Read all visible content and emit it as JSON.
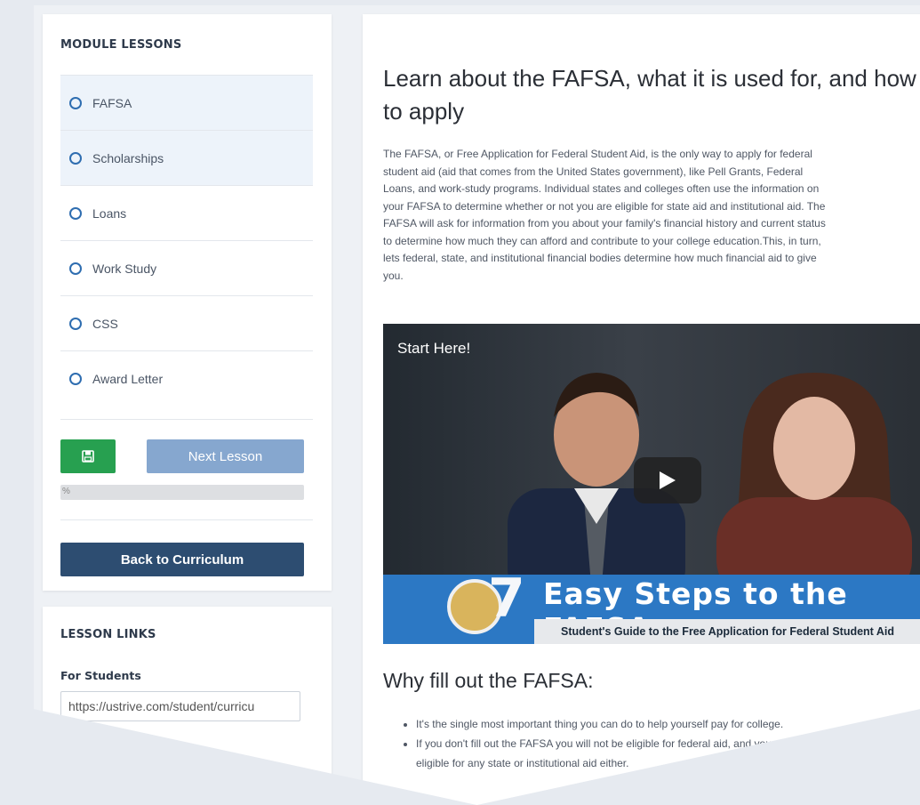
{
  "sidebar": {
    "module_title": "MODULE LESSONS",
    "lessons": [
      {
        "label": "FAFSA"
      },
      {
        "label": "Scholarships"
      },
      {
        "label": "Loans"
      },
      {
        "label": "Work Study"
      },
      {
        "label": "CSS"
      },
      {
        "label": "Award Letter"
      }
    ],
    "save_icon": "floppy-disk-icon",
    "next_label": "Next Lesson",
    "progress_label": "%",
    "back_label": "Back to Curriculum",
    "links_title": "LESSON LINKS",
    "for_students": "For Students",
    "student_link": "https://ustrive.com/student/curricu"
  },
  "main": {
    "title": "Learn about the FAFSA, what it is used for, and how to apply",
    "paragraph_lines": [
      "The FAFSA, or Free Application for Federal Student Aid, is the only way to apply for federal",
      "student aid (aid that comes from the United States government), like Pell Grants, Federal",
      "Loans, and work-study programs. Individual states and colleges often use the information on",
      "your FAFSA to determine whether or not you are eligible for state aid and institutional aid. The",
      "FAFSA will ask for information from you about your family's financial history and current status",
      "to determine how much they can afford and contribute to your college education.This, in turn,",
      "lets federal, state, and institutional financial bodies determine how much financial aid to give",
      "you."
    ],
    "video": {
      "overlay_text": "Start Here!",
      "banner_number": "7",
      "banner_title": "Easy Steps to the FAFSA",
      "banner_subtitle": "Student's Guide to the Free Application for Federal Student Aid"
    },
    "why_heading": "Why fill out the FAFSA:",
    "why_items": [
      "It's the single most important thing you can do to help yourself pay for college.",
      "If you don't fill out the FAFSA you will not be eligible for federal aid, and you might not be",
      "eligible for any state or institutional aid either."
    ]
  },
  "colors": {
    "save_green": "#27a050",
    "next_blue": "#86a7cf",
    "back_navy": "#2d4d71",
    "radio_blue": "#2e6db0"
  }
}
